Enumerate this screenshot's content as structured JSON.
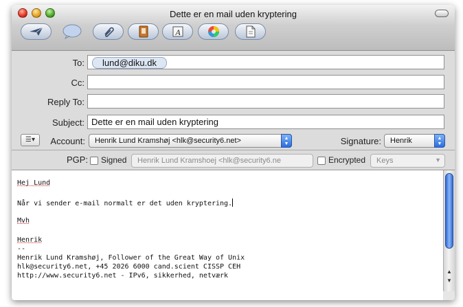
{
  "window": {
    "title": "Dette er en mail uden kryptering"
  },
  "toolbar": {
    "buttons": [
      {
        "name": "send",
        "icon": "send-icon"
      },
      {
        "name": "chat",
        "icon": "chat-icon"
      },
      {
        "name": "attach",
        "icon": "paperclip-icon"
      },
      {
        "name": "address",
        "icon": "address-book-icon"
      },
      {
        "name": "fonts",
        "icon": "fonts-icon"
      },
      {
        "name": "colors",
        "icon": "color-wheel-icon"
      },
      {
        "name": "save-draft",
        "icon": "save-draft-icon"
      }
    ]
  },
  "headers": {
    "to_label": "To:",
    "to_token": "lund@diku.dk",
    "cc_label": "Cc:",
    "cc_value": "",
    "replyto_label": "Reply To:",
    "replyto_value": "",
    "subject_label": "Subject:",
    "subject_value": "Dette er en mail uden kryptering",
    "account_label": "Account:",
    "account_value": "Henrik Lund Kramshøj <hlk@security6.net>",
    "signature_label": "Signature:",
    "signature_value": "Henrik",
    "action_menu": "☰▾"
  },
  "pgp": {
    "label": "PGP:",
    "signed_label": "Signed",
    "signed_checked": false,
    "signer_value": "Henrik Lund Kramshoej <hlk@security6.ne",
    "encrypted_label": "Encrypted",
    "encrypted_checked": false,
    "keys_value": "Keys"
  },
  "body": {
    "greeting": "Hej Lund",
    "line1": "Når vi sender e-mail normalt er det uden kryptering.",
    "closing": "Mvh",
    "name": "Henrik",
    "sig_sep": "--",
    "sig1": "Henrik Lund Kramshøj, Follower of the Great Way of Unix",
    "sig2": "hlk@security6.net, +45 2026 6000 cand.scient CISSP CEH",
    "sig3": "http://www.security6.net - IPv6, sikkerhed, netværk"
  },
  "colors": {
    "accent": "#2a6ee0",
    "chrome": "#dcdcdc",
    "spell_underline": "#e02020"
  }
}
